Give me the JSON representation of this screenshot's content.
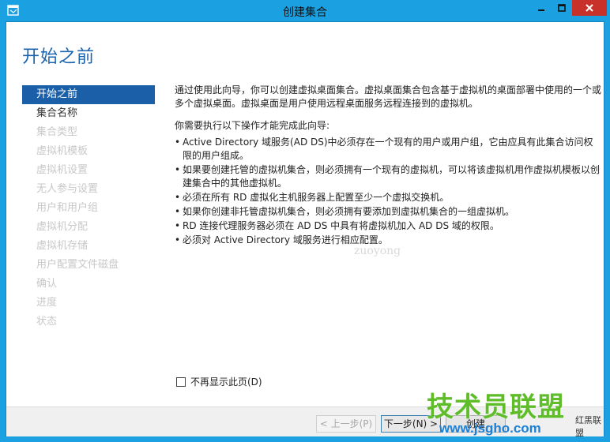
{
  "window": {
    "title": "创建集合"
  },
  "page": {
    "title": "开始之前"
  },
  "sidebar": {
    "items": [
      {
        "label": "开始之前",
        "state": "active"
      },
      {
        "label": "集合名称",
        "state": "enabled"
      },
      {
        "label": "集合类型",
        "state": "disabled"
      },
      {
        "label": "虚拟机模板",
        "state": "disabled"
      },
      {
        "label": "虚拟机设置",
        "state": "disabled"
      },
      {
        "label": "无人参与设置",
        "state": "disabled"
      },
      {
        "label": "用户和用户组",
        "state": "disabled"
      },
      {
        "label": "虚拟机分配",
        "state": "disabled"
      },
      {
        "label": "虚拟机存储",
        "state": "disabled"
      },
      {
        "label": "用户配置文件磁盘",
        "state": "disabled"
      },
      {
        "label": "确认",
        "state": "disabled"
      },
      {
        "label": "进度",
        "state": "disabled"
      },
      {
        "label": "状态",
        "state": "disabled"
      }
    ]
  },
  "content": {
    "intro": "通过使用此向导，你可以创建虚拟桌面集合。虚拟桌面集合包含基于虚拟机的桌面部署中使用的一个或多个虚拟桌面。虚拟桌面是用户使用远程桌面服务远程连接到的虚拟机。",
    "requirements_heading": "你需要执行以下操作才能完成此向导:",
    "bullets": [
      "Active Directory 域服务(AD DS)中必须存在一个现有的用户或用户组，它由应具有此集合访问权限的用户组成。",
      "如果要创建托管的虚拟机集合，则必须拥有一个现有的虚拟机，可以将该虚拟机用作虚拟机模板以创建集合中的其他虚拟机。",
      "必须在所有 RD 虚拟化主机服务器上配置至少一个虚拟交换机。",
      "如果你创建非托管虚拟机集合，则必须拥有要添加到虚拟机集合的一组虚拟机。",
      "RD 连接代理服务器必须在 AD DS 中具有将虚拟机加入 AD DS 域的权限。",
      "必须对 Active Directory 域服务进行相应配置。"
    ]
  },
  "options": {
    "dont_show_label": "不再显示此页(D)"
  },
  "footer": {
    "prev_label": "< 上一步(P)",
    "next_label": "下一步(N) >",
    "create_label": "创建"
  },
  "watermark": {
    "faint_text": "zuoyong",
    "brand": "技术员联盟",
    "url": "www.jsgho.com",
    "red_text": "红黑联盟"
  },
  "colors": {
    "accent": "#1ba1e2",
    "title": "#1a63b0",
    "active_item": "#1a5fa8",
    "close": "#c7312a"
  }
}
